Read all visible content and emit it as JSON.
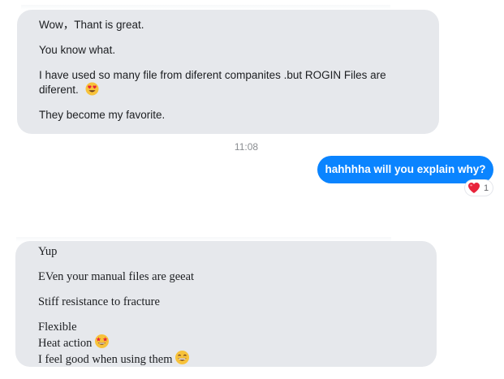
{
  "messages": {
    "first_incoming": {
      "line1": "Wow，Thant is great.",
      "line2": "You  know what.",
      "line3a": "I have used so many file  from diferent companites .but ROGIN Files are",
      "line3b": " diferent.",
      "line4": "They become my favorite."
    },
    "timestamp": "11:08",
    "outgoing": {
      "text": "hahhhha will you explain why?",
      "reaction_emoji": "heart",
      "reaction_count": "1"
    },
    "second_incoming": {
      "line1": "Yup",
      "line2": "EVen your manual files are geeat",
      "line3": "Stiff resistance to fracture",
      "line4": "Flexible",
      "line5": "Heat action",
      "line6": "I feel good when using them"
    }
  },
  "icons": {
    "heart_eyes": "heart-eyes-emoji",
    "star_struck": "star-struck-emoji",
    "grin": "grinning-emoji",
    "heart": "red-heart-emoji"
  },
  "colors": {
    "incoming_bubble": "#e6e8ec",
    "outgoing_bubble": "#0a84ff",
    "timestamp": "#8a8d91"
  }
}
